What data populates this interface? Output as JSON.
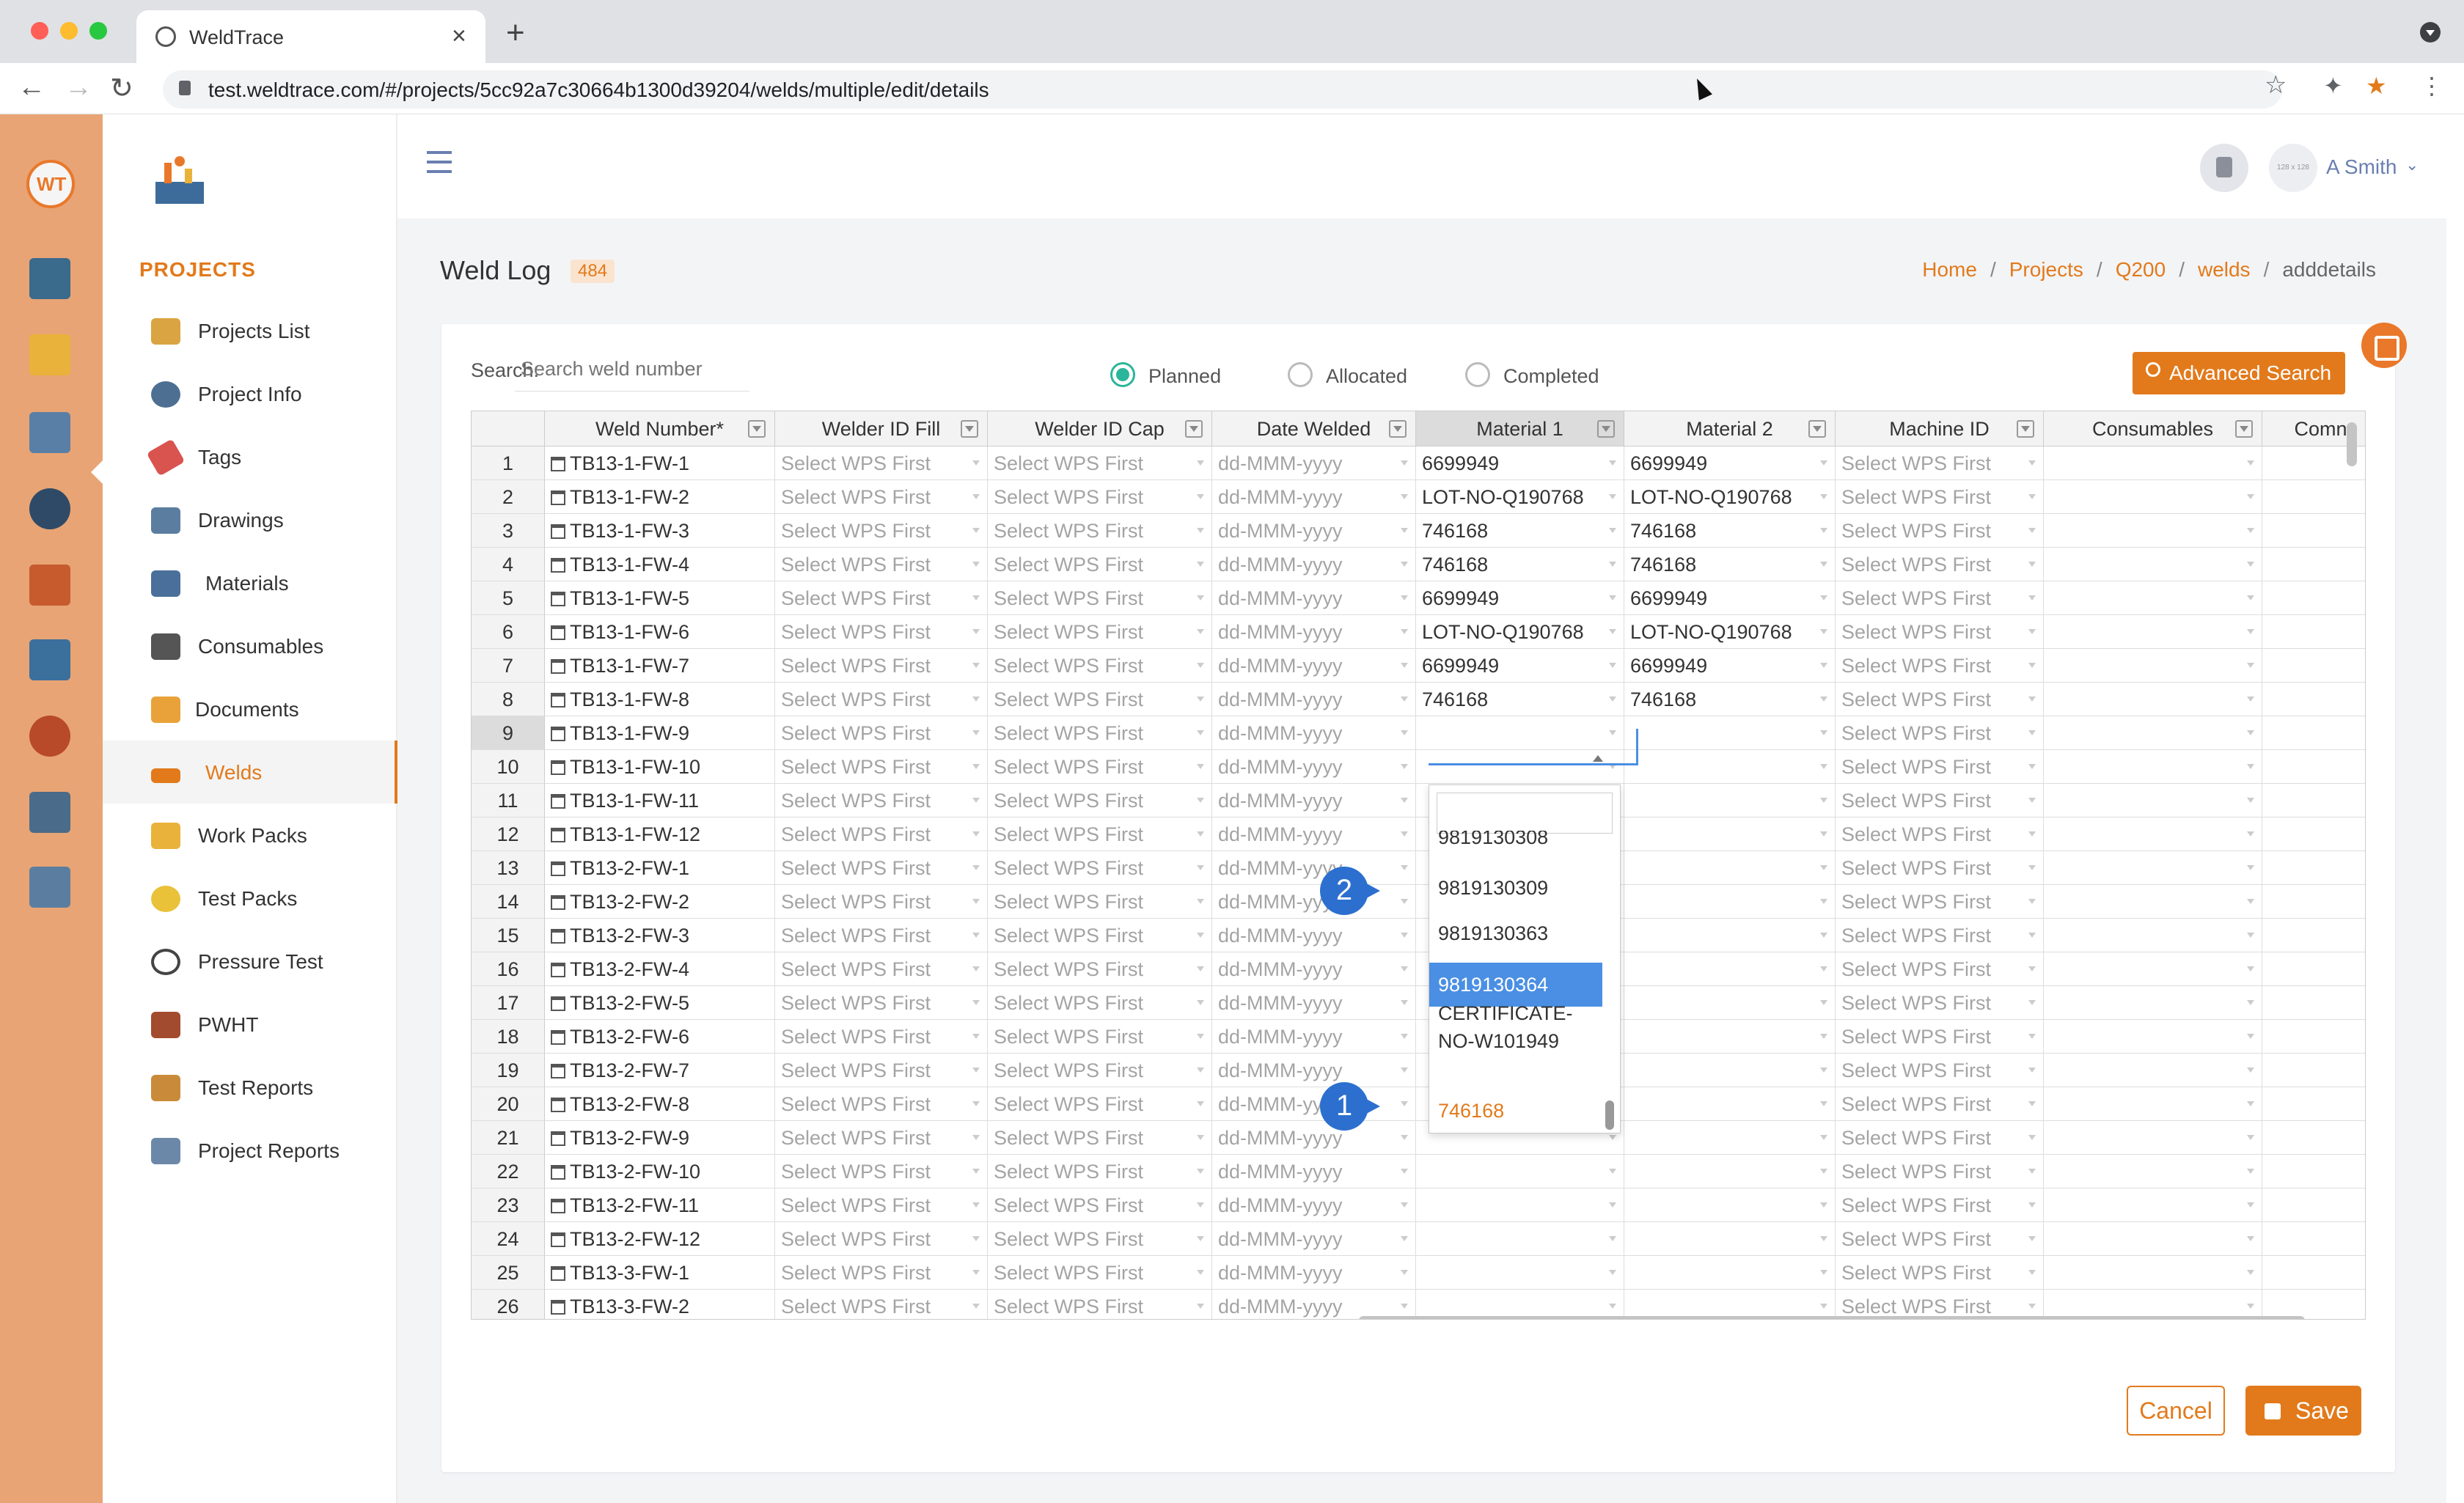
{
  "browser": {
    "tab_title": "WeldTrace",
    "url": "test.weldtrace.com/#/projects/5cc92a7c30664b1300d39204/welds/multiple/edit/details"
  },
  "sidebar": {
    "section_title": "PROJECTS",
    "items": [
      {
        "label": "Projects List",
        "icon": "folder-camera-icon"
      },
      {
        "label": "Project Info",
        "icon": "gears-icon"
      },
      {
        "label": "Tags",
        "icon": "tag-icon"
      },
      {
        "label": "Drawings",
        "icon": "drafting-icon"
      },
      {
        "label": "Materials",
        "icon": "pipes-icon"
      },
      {
        "label": "Consumables",
        "icon": "rods-icon"
      },
      {
        "label": "Documents",
        "icon": "folder-icon"
      },
      {
        "label": "Welds",
        "icon": "welding-icon"
      },
      {
        "label": "Work Packs",
        "icon": "box-icon"
      },
      {
        "label": "Test Packs",
        "icon": "radiation-icon"
      },
      {
        "label": "Pressure Test",
        "icon": "gauge-icon"
      },
      {
        "label": "PWHT",
        "icon": "heater-icon"
      },
      {
        "label": "Test Reports",
        "icon": "report-icon"
      },
      {
        "label": "Project Reports",
        "icon": "chart-report-icon"
      }
    ],
    "active_item": "Welds"
  },
  "header": {
    "user": "A Smith",
    "avatar_text": "128 x 128"
  },
  "page": {
    "title": "Weld Log",
    "count": "484",
    "breadcrumb": [
      "Home",
      "Projects",
      "Q200",
      "welds",
      "adddetails"
    ]
  },
  "toolbar": {
    "search_label": "Search:",
    "search_placeholder": "Search weld number",
    "status_filter": [
      "Planned",
      "Allocated",
      "Completed"
    ],
    "status_selected": "Planned",
    "advanced_search": "Advanced Search"
  },
  "grid": {
    "columns": [
      "Weld Number*",
      "Welder ID Fill",
      "Welder ID Cap",
      "Date Welded",
      "Material 1",
      "Material 2",
      "Machine ID",
      "Consumables",
      "Comn"
    ],
    "placeholders": {
      "wps": "Select WPS First",
      "date": "dd-MMM-yyyy"
    },
    "rows": [
      {
        "n": "1",
        "weld": "TB13-1-FW-1",
        "m1": "6699949",
        "m2": "6699949"
      },
      {
        "n": "2",
        "weld": "TB13-1-FW-2",
        "m1": "LOT-NO-Q190768",
        "m2": "LOT-NO-Q190768"
      },
      {
        "n": "3",
        "weld": "TB13-1-FW-3",
        "m1": "746168",
        "m2": "746168"
      },
      {
        "n": "4",
        "weld": "TB13-1-FW-4",
        "m1": "746168",
        "m2": "746168"
      },
      {
        "n": "5",
        "weld": "TB13-1-FW-5",
        "m1": "6699949",
        "m2": "6699949"
      },
      {
        "n": "6",
        "weld": "TB13-1-FW-6",
        "m1": "LOT-NO-Q190768",
        "m2": "LOT-NO-Q190768"
      },
      {
        "n": "7",
        "weld": "TB13-1-FW-7",
        "m1": "6699949",
        "m2": "6699949"
      },
      {
        "n": "8",
        "weld": "TB13-1-FW-8",
        "m1": "746168",
        "m2": "746168"
      },
      {
        "n": "9",
        "weld": "TB13-1-FW-9",
        "m1": "",
        "m2": ""
      },
      {
        "n": "10",
        "weld": "TB13-1-FW-10",
        "m1": "",
        "m2": ""
      },
      {
        "n": "11",
        "weld": "TB13-1-FW-11",
        "m1": "",
        "m2": ""
      },
      {
        "n": "12",
        "weld": "TB13-1-FW-12",
        "m1": "",
        "m2": ""
      },
      {
        "n": "13",
        "weld": "TB13-2-FW-1",
        "m1": "",
        "m2": ""
      },
      {
        "n": "14",
        "weld": "TB13-2-FW-2",
        "m1": "",
        "m2": ""
      },
      {
        "n": "15",
        "weld": "TB13-2-FW-3",
        "m1": "",
        "m2": ""
      },
      {
        "n": "16",
        "weld": "TB13-2-FW-4",
        "m1": "",
        "m2": ""
      },
      {
        "n": "17",
        "weld": "TB13-2-FW-5",
        "m1": "",
        "m2": ""
      },
      {
        "n": "18",
        "weld": "TB13-2-FW-6",
        "m1": "",
        "m2": ""
      },
      {
        "n": "19",
        "weld": "TB13-2-FW-7",
        "m1": "",
        "m2": ""
      },
      {
        "n": "20",
        "weld": "TB13-2-FW-8",
        "m1": "",
        "m2": ""
      },
      {
        "n": "21",
        "weld": "TB13-2-FW-9",
        "m1": "",
        "m2": ""
      },
      {
        "n": "22",
        "weld": "TB13-2-FW-10",
        "m1": "",
        "m2": ""
      },
      {
        "n": "23",
        "weld": "TB13-2-FW-11",
        "m1": "",
        "m2": ""
      },
      {
        "n": "24",
        "weld": "TB13-2-FW-12",
        "m1": "",
        "m2": ""
      },
      {
        "n": "25",
        "weld": "TB13-3-FW-1",
        "m1": "",
        "m2": ""
      },
      {
        "n": "26",
        "weld": "TB13-3-FW-2",
        "m1": "",
        "m2": ""
      }
    ],
    "selected_row": "9"
  },
  "dropdown": {
    "options": [
      "9819130308",
      "9819130309",
      "9819130363",
      "9819130364",
      "CERTIFICATE-NO-W101949",
      "746168"
    ],
    "highlighted": "9819130364",
    "selected": "746168",
    "markers": [
      "1",
      "2"
    ]
  },
  "actions": {
    "cancel": "Cancel",
    "save": "Save"
  },
  "colors": {
    "accent": "#e27a1b",
    "rail": "#e8a474",
    "highlight": "#4a8fe3",
    "radio": "#2bb59a",
    "marker": "#2c6fcf"
  }
}
